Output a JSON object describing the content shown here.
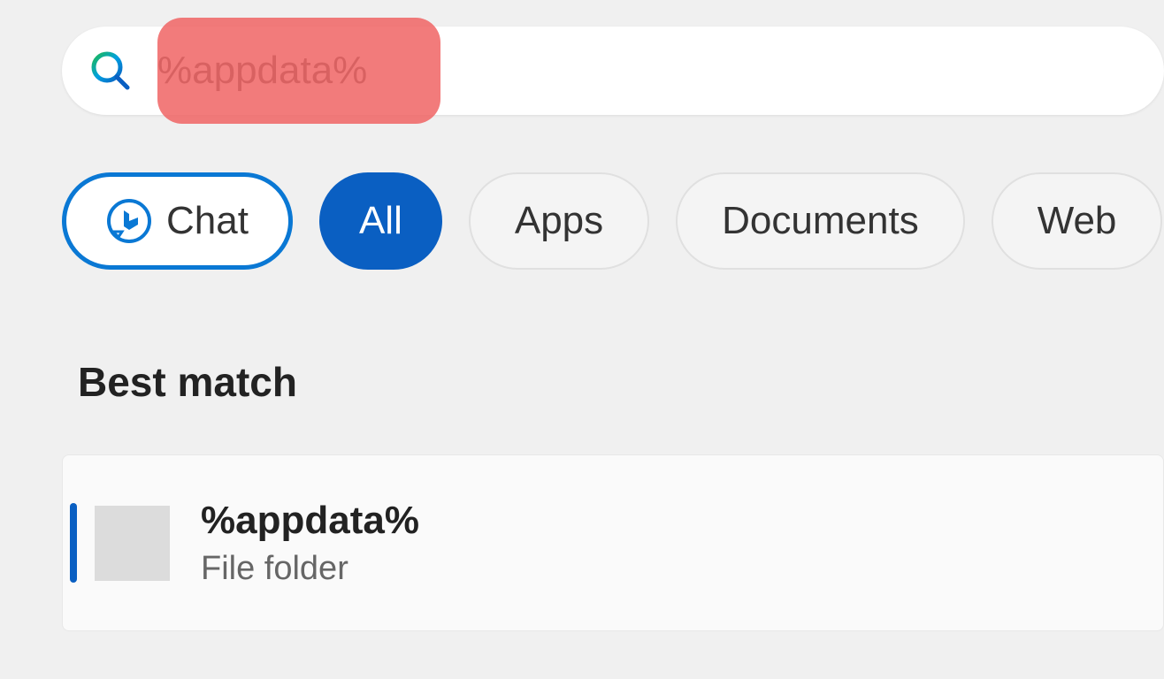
{
  "search": {
    "value": "%appdata%"
  },
  "tabs": {
    "chat": "Chat",
    "all": "All",
    "apps": "Apps",
    "documents": "Documents",
    "web": "Web"
  },
  "section": {
    "best_match": "Best match"
  },
  "result": {
    "title": "%appdata%",
    "subtitle": "File folder"
  }
}
